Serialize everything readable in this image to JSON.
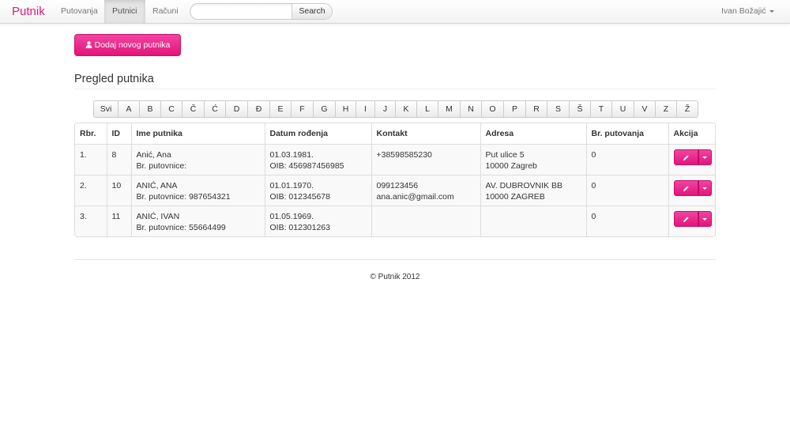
{
  "navbar": {
    "brand": "Putnik",
    "items": [
      {
        "label": "Putovanja"
      },
      {
        "label": "Putnici"
      },
      {
        "label": "Računi"
      }
    ],
    "search": {
      "placeholder": "",
      "value": "",
      "button_label": "Search"
    },
    "user": {
      "name": "Ivan Božajić"
    }
  },
  "actions": {
    "add_label": "Dodaj novog putnika"
  },
  "page": {
    "title": "Pregled putnika"
  },
  "letters": [
    "Svi",
    "A",
    "B",
    "C",
    "Č",
    "Ć",
    "D",
    "Đ",
    "E",
    "F",
    "G",
    "H",
    "I",
    "J",
    "K",
    "L",
    "M",
    "N",
    "O",
    "P",
    "R",
    "S",
    "Š",
    "T",
    "U",
    "V",
    "Z",
    "Ž"
  ],
  "table": {
    "headers": [
      "Rbr.",
      "ID",
      "Ime putnika",
      "Datum rođenja",
      "Kontakt",
      "Adresa",
      "Br. putovanja",
      "Akcija"
    ],
    "rows": [
      {
        "rbr": "1.",
        "id": "8",
        "name": "Anić, Ana",
        "passport": "Br. putovnice:",
        "dob": "01.03.1981.",
        "oib": "OIB: 456987456985",
        "contact1": "+38598585230",
        "contact2": "",
        "address1": "Put ulice 5",
        "address2": "10000 Zagreb",
        "trips": "0"
      },
      {
        "rbr": "2.",
        "id": "10",
        "name": "ANIĆ, ANA",
        "passport": "Br. putovnice: 987654321",
        "dob": "01.01.1970.",
        "oib": "OIB: 012345678",
        "contact1": "099123456",
        "contact2": "ana.anic@gmail.com",
        "address1": "AV. DUBROVNIK BB",
        "address2": "10000 ZAGREB",
        "trips": "0"
      },
      {
        "rbr": "3.",
        "id": "11",
        "name": "ANIĆ, IVAN",
        "passport": "Br. putovnice: 55664499",
        "dob": "01.05.1969.",
        "oib": "OIB: 012301263",
        "contact1": "",
        "contact2": "",
        "address1": "",
        "address2": "",
        "trips": "0"
      }
    ]
  },
  "footer": {
    "text": "© Putnik 2012"
  },
  "colors": {
    "brand": "#e4177b",
    "button": "#e4147a"
  }
}
